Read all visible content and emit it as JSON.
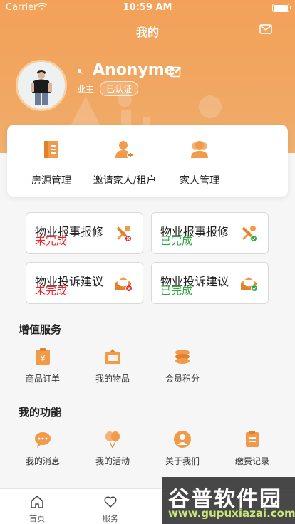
{
  "status": {
    "carrier": "Carrier",
    "time": "10:59 AM"
  },
  "header": {
    "title": "我的"
  },
  "profile": {
    "name": "Anonyme",
    "role": "业主",
    "badge": "已认证"
  },
  "quick_actions": [
    {
      "label": "房源管理",
      "icon": "document-icon"
    },
    {
      "label": "邀请家人/租户",
      "icon": "add-user-icon"
    },
    {
      "label": "家人管理",
      "icon": "group-icon"
    }
  ],
  "tiles": [
    {
      "title": "物业报事报修",
      "status": "未完成",
      "icon": "tools-x-icon"
    },
    {
      "title": "物业报事报修",
      "status": "已完成",
      "icon": "tools-check-icon"
    },
    {
      "title": "物业投诉建议",
      "status": "未完成",
      "icon": "envelope-x-icon"
    },
    {
      "title": "物业投诉建议",
      "status": "已完成",
      "icon": "envelope-check-icon"
    }
  ],
  "value_services": {
    "title": "增值服务",
    "items": [
      {
        "label": "商品订单",
        "icon": "order-icon"
      },
      {
        "label": "我的物品",
        "icon": "secondhand-icon"
      },
      {
        "label": "会员积分",
        "icon": "coins-icon"
      }
    ]
  },
  "my_functions": {
    "title": "我的功能",
    "items": [
      {
        "label": "我的消息",
        "icon": "chat-icon"
      },
      {
        "label": "我的活动",
        "icon": "balloons-icon"
      },
      {
        "label": "关于我们",
        "icon": "person-icon"
      },
      {
        "label": "缴费记录",
        "icon": "clipboard-icon"
      }
    ]
  },
  "tabbar": [
    {
      "label": "首页",
      "icon": "home-icon"
    },
    {
      "label": "服务",
      "icon": "heart-icon"
    }
  ],
  "watermark": {
    "line1": "谷普软件园",
    "line2": "www.gupuxiazai.com"
  },
  "colors": {
    "accent": "#f3a158",
    "red": "#e8272a",
    "green": "#2fa843"
  }
}
